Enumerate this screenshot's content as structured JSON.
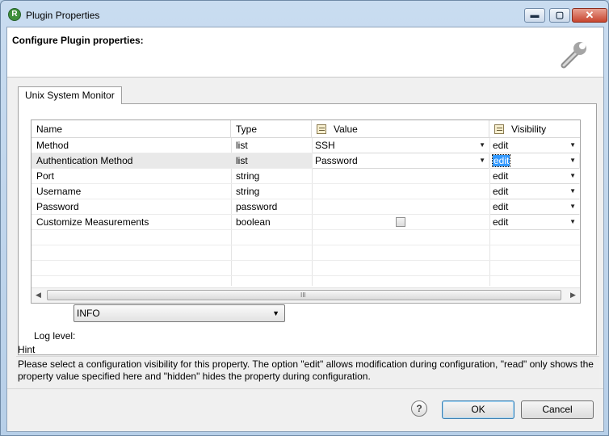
{
  "window": {
    "title": "Plugin Properties",
    "app_icon": "R"
  },
  "title_buttons": {
    "minimize": "▬",
    "maximize": "▢",
    "close": "✕"
  },
  "header": {
    "title": "Configure Plugin properties:"
  },
  "tab": {
    "label": "Unix System Monitor"
  },
  "table": {
    "columns": {
      "name": "Name",
      "type": "Type",
      "value": "Value",
      "visibility": "Visibility"
    },
    "rows": [
      {
        "name": "Method",
        "type": "list",
        "value": "SSH",
        "visibility": "edit"
      },
      {
        "name": "Authentication Method",
        "type": "list",
        "value": "Password",
        "visibility": "edit"
      },
      {
        "name": "Port",
        "type": "string",
        "value": "",
        "visibility": "edit"
      },
      {
        "name": "Username",
        "type": "string",
        "value": "",
        "visibility": "edit"
      },
      {
        "name": "Password",
        "type": "password",
        "value": "",
        "visibility": "edit"
      },
      {
        "name": "Customize Measurements",
        "type": "boolean",
        "value": "",
        "visibility": "edit"
      }
    ],
    "selected_row": 1,
    "scroll_grip": "III"
  },
  "log_level": {
    "label": "Log level:",
    "value": "INFO"
  },
  "hint": {
    "title": "Hint",
    "text": "Please select a configuration visibility for this property. The option \"edit\" allows modification during configuration, \"read\" only shows the property value specified here and \"hidden\" hides the property during configuration."
  },
  "buttons": {
    "help": "?",
    "ok": "OK",
    "cancel": "Cancel"
  },
  "colors": {
    "selection": "#3399ff",
    "title_bar": "#c9dcf0",
    "close_button": "#c8452f"
  }
}
